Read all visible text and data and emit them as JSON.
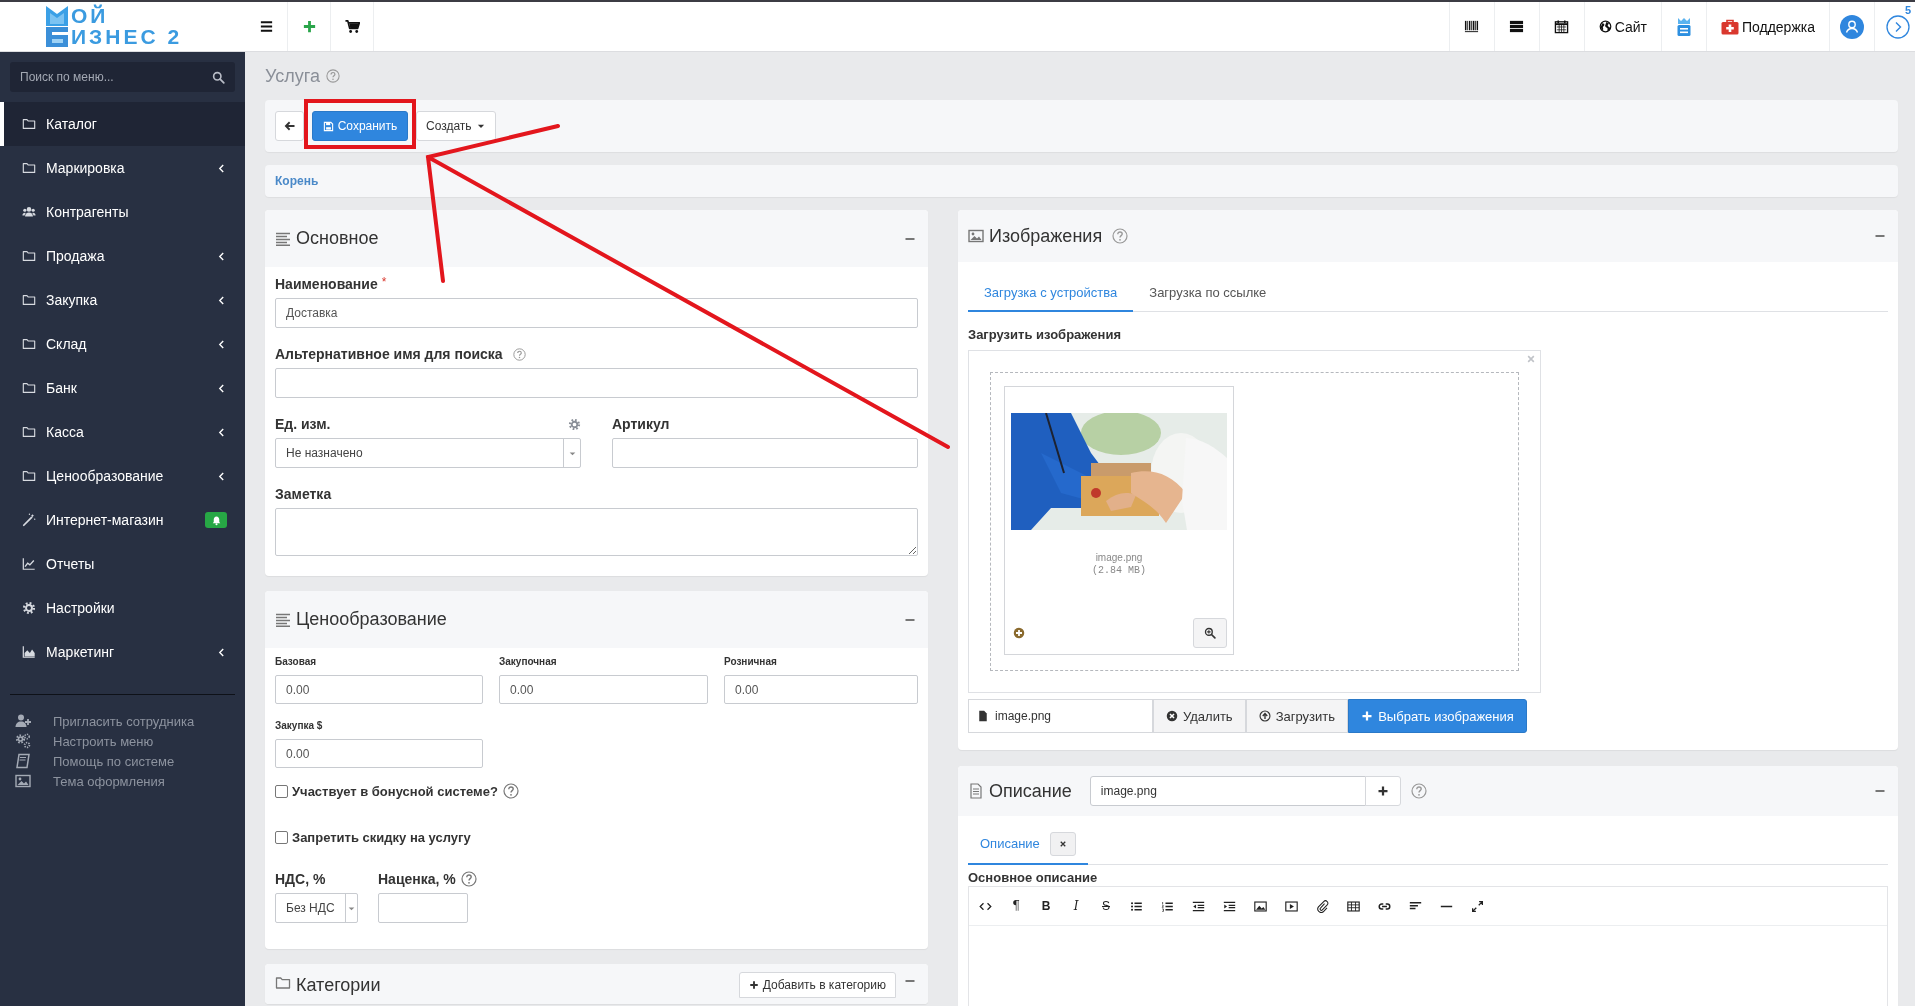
{
  "logo": {
    "line_1": "ОЙ",
    "line_2": "ИЗНЕС 2"
  },
  "topbar": {
    "site_link": "Сайт",
    "support_link": "Поддержка",
    "notifications_badge": "5"
  },
  "sidebar": {
    "search": {
      "placeholder": "Поиск по меню..."
    },
    "items": [
      {
        "label": "Каталог",
        "selected": true,
        "has_submenu": false,
        "notification": false
      },
      {
        "label": "Маркировка",
        "selected": false,
        "has_submenu": true,
        "notification": false
      },
      {
        "label": "Контрагенты",
        "selected": false,
        "has_submenu": false,
        "notification": false
      },
      {
        "label": "Продажа",
        "selected": false,
        "has_submenu": true,
        "notification": false
      },
      {
        "label": "Закупка",
        "selected": false,
        "has_submenu": true,
        "notification": false
      },
      {
        "label": "Склад",
        "selected": false,
        "has_submenu": true,
        "notification": false
      },
      {
        "label": "Банк",
        "selected": false,
        "has_submenu": true,
        "notification": false
      },
      {
        "label": "Касса",
        "selected": false,
        "has_submenu": true,
        "notification": false
      },
      {
        "label": "Ценообразование",
        "selected": false,
        "has_submenu": true,
        "notification": false
      },
      {
        "label": "Интернет-магазин",
        "selected": false,
        "has_submenu": false,
        "notification": true
      },
      {
        "label": "Отчеты",
        "selected": false,
        "has_submenu": false,
        "notification": false
      },
      {
        "label": "Настройки",
        "selected": false,
        "has_submenu": false,
        "notification": false
      },
      {
        "label": "Маркетинг",
        "selected": false,
        "has_submenu": true,
        "notification": false
      }
    ],
    "footer_links": [
      "Пригласить сотрудника",
      "Настроить меню",
      "Помощь по системе",
      "Тема оформления"
    ]
  },
  "page": {
    "title": "Услуга"
  },
  "toolbar": {
    "save": "Сохранить",
    "create": "Создать"
  },
  "breadcrumb": "Корень",
  "main_panel": {
    "title": "Основное",
    "name": {
      "label": "Наименование",
      "required_mark": "*",
      "value": "Доставка"
    },
    "alt_name": {
      "label": "Альтернативное имя для поиска",
      "help": true
    },
    "unit": {
      "label": "Ед. изм.",
      "value": "Не назначено"
    },
    "article": {
      "label": "Артикул"
    },
    "note": {
      "label": "Заметка"
    }
  },
  "pricing_panel": {
    "title": "Ценообразование",
    "prices": [
      {
        "label": "Базовая",
        "value": "0.00"
      },
      {
        "label": "Закупочная",
        "value": "0.00"
      },
      {
        "label": "Розничная",
        "value": "0.00"
      },
      {
        "label": "Закупка $",
        "value": "0.00"
      }
    ],
    "checkboxes": [
      {
        "label": "Участвует в бонусной системе?",
        "checked": false,
        "help": true
      },
      {
        "label": "Запретить скидку на услугу",
        "checked": false,
        "help": false
      }
    ],
    "vat": {
      "label": "НДС, %",
      "value": "Без НДС"
    },
    "markup": {
      "label": "Наценка, %",
      "help": true
    }
  },
  "categories_panel": {
    "title": "Категории",
    "add_button": "Добавить в категорию"
  },
  "images_panel": {
    "title": "Изображения",
    "tabs": [
      {
        "label": "Загрузка с устройства",
        "selected": true
      },
      {
        "label": "Загрузка по ссылке",
        "selected": false
      }
    ],
    "upload_label": "Загрузить изображения",
    "preview": {
      "kind": "picture",
      "file_name": "image.png",
      "file_size": "(2.84 MB)"
    },
    "file_field": "image.png",
    "buttons": {
      "remove": "Удалить",
      "upload": "Загрузить",
      "browse": "Выбрать изображения"
    }
  },
  "description_panel": {
    "title": "Описание",
    "input_value": "image.png",
    "tabs": [
      {
        "label": "Описание",
        "selected": true
      }
    ],
    "editor_label": "Основное описание",
    "editor_toolbar": [
      {
        "kind": "icon"
      },
      {
        "kind": "glyph",
        "text": "¶"
      },
      {
        "kind": "bold",
        "text": "B"
      },
      {
        "kind": "italic",
        "text": "I"
      },
      {
        "kind": "strike",
        "text": "S"
      },
      {
        "kind": "icon"
      },
      {
        "kind": "icon"
      },
      {
        "kind": "icon"
      },
      {
        "kind": "icon"
      },
      {
        "kind": "icon"
      },
      {
        "kind": "icon"
      },
      {
        "kind": "icon"
      },
      {
        "kind": "icon"
      },
      {
        "kind": "icon"
      },
      {
        "kind": "icon"
      },
      {
        "kind": "icon"
      },
      {
        "kind": "icon"
      }
    ]
  }
}
